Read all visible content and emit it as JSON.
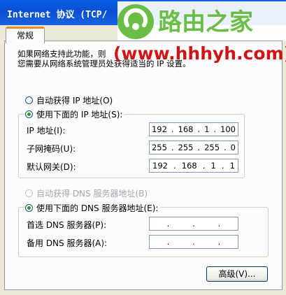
{
  "window": {
    "title": "Internet 协议 (TCP/"
  },
  "watermark": {
    "site_name": "路由之家",
    "url": "(www.hhhyh.com)",
    "logo_color": "#6abe45",
    "url_color": "#d01414"
  },
  "tabs": [
    {
      "label": "常规"
    }
  ],
  "description": {
    "line1": "如果网络支持此功能，则",
    "line2": "您需要从网络系统管理员处获得适当的 IP 设置。"
  },
  "ip_mode": {
    "auto_label": "自动获得 IP 地址(O)",
    "manual_label": "使用下面的 IP 地址(S):",
    "selected": "manual"
  },
  "ip_fields": [
    {
      "label": "IP 地址(I):",
      "octets": [
        "192",
        "168",
        "1",
        "100"
      ]
    },
    {
      "label": "子网掩码(U):",
      "octets": [
        "255",
        "255",
        "255",
        "0"
      ]
    },
    {
      "label": "默认网关(D):",
      "octets": [
        "192",
        "168",
        "1",
        "1"
      ]
    }
  ],
  "dns_mode": {
    "auto_label": "自动获得 DNS 服务器地址(B)",
    "manual_label": "使用下面的 DNS 服务器地址(E):",
    "selected": "manual"
  },
  "dns_fields": [
    {
      "label": "首选 DNS 服务器(P):",
      "octets": [
        "",
        "",
        "",
        ""
      ]
    },
    {
      "label": "备用 DNS 服务器(A):",
      "octets": [
        "",
        "",
        "",
        ""
      ]
    }
  ],
  "buttons": {
    "advanced": "高级(V)..."
  }
}
